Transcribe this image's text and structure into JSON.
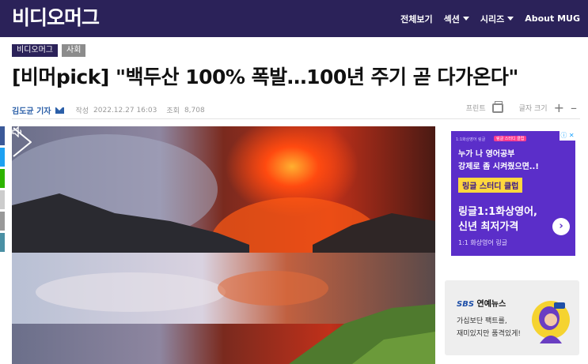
{
  "header": {
    "logo": "비디오머그",
    "nav": [
      {
        "label": "전체보기",
        "has_dropdown": false
      },
      {
        "label": "섹션",
        "has_dropdown": true
      },
      {
        "label": "시리즈",
        "has_dropdown": true
      },
      {
        "label": "About MUG",
        "has_dropdown": false
      }
    ]
  },
  "article": {
    "tags": [
      "비디오머그",
      "사회"
    ],
    "title": "[비머pick] \"백두산 100% 폭발…100년 주기 곧 다가온다\"",
    "reporter": "김도균 기자",
    "written_label": "작성",
    "written_date": "2022.12.27 16:03",
    "views_label": "조회",
    "views": "8,708",
    "print_label": "프린트",
    "font_size_label": "글자 크기",
    "font_increase": "+",
    "font_decrease": "–"
  },
  "video": {
    "mute_icon": "speaker-icon",
    "play_icon": "play-icon"
  },
  "social_colors": [
    "#3b5998",
    "#1da1f2",
    "#2db400",
    "#cccccc",
    "#999999",
    "#4a90a4"
  ],
  "ads": {
    "ad1": {
      "top_text": "1:1화상영어 링글",
      "badge": "링글 스터디 클럽",
      "close": "ⓘ ✕",
      "copy_line1": "누가 나 영어공부",
      "copy_line2": "강제로 좀 시켜줬으면..!",
      "cta": "링글 스터디 클럽",
      "headline_line1": "링글1:1화상영어,",
      "headline_line2": "신년 최저가격",
      "sub": "1:1 화상영어 링글",
      "arrow": "›",
      "bg_color": "#5b2ec9"
    },
    "ad2": {
      "logo_sbs": "SBS",
      "logo_rest": " 연예뉴스",
      "copy_line1": "가십보단 팩트를,",
      "copy_line2": "재미있지만 품격있게!"
    }
  },
  "colors": {
    "brand": "#2b2259",
    "reporter": "#2b5fa8"
  }
}
